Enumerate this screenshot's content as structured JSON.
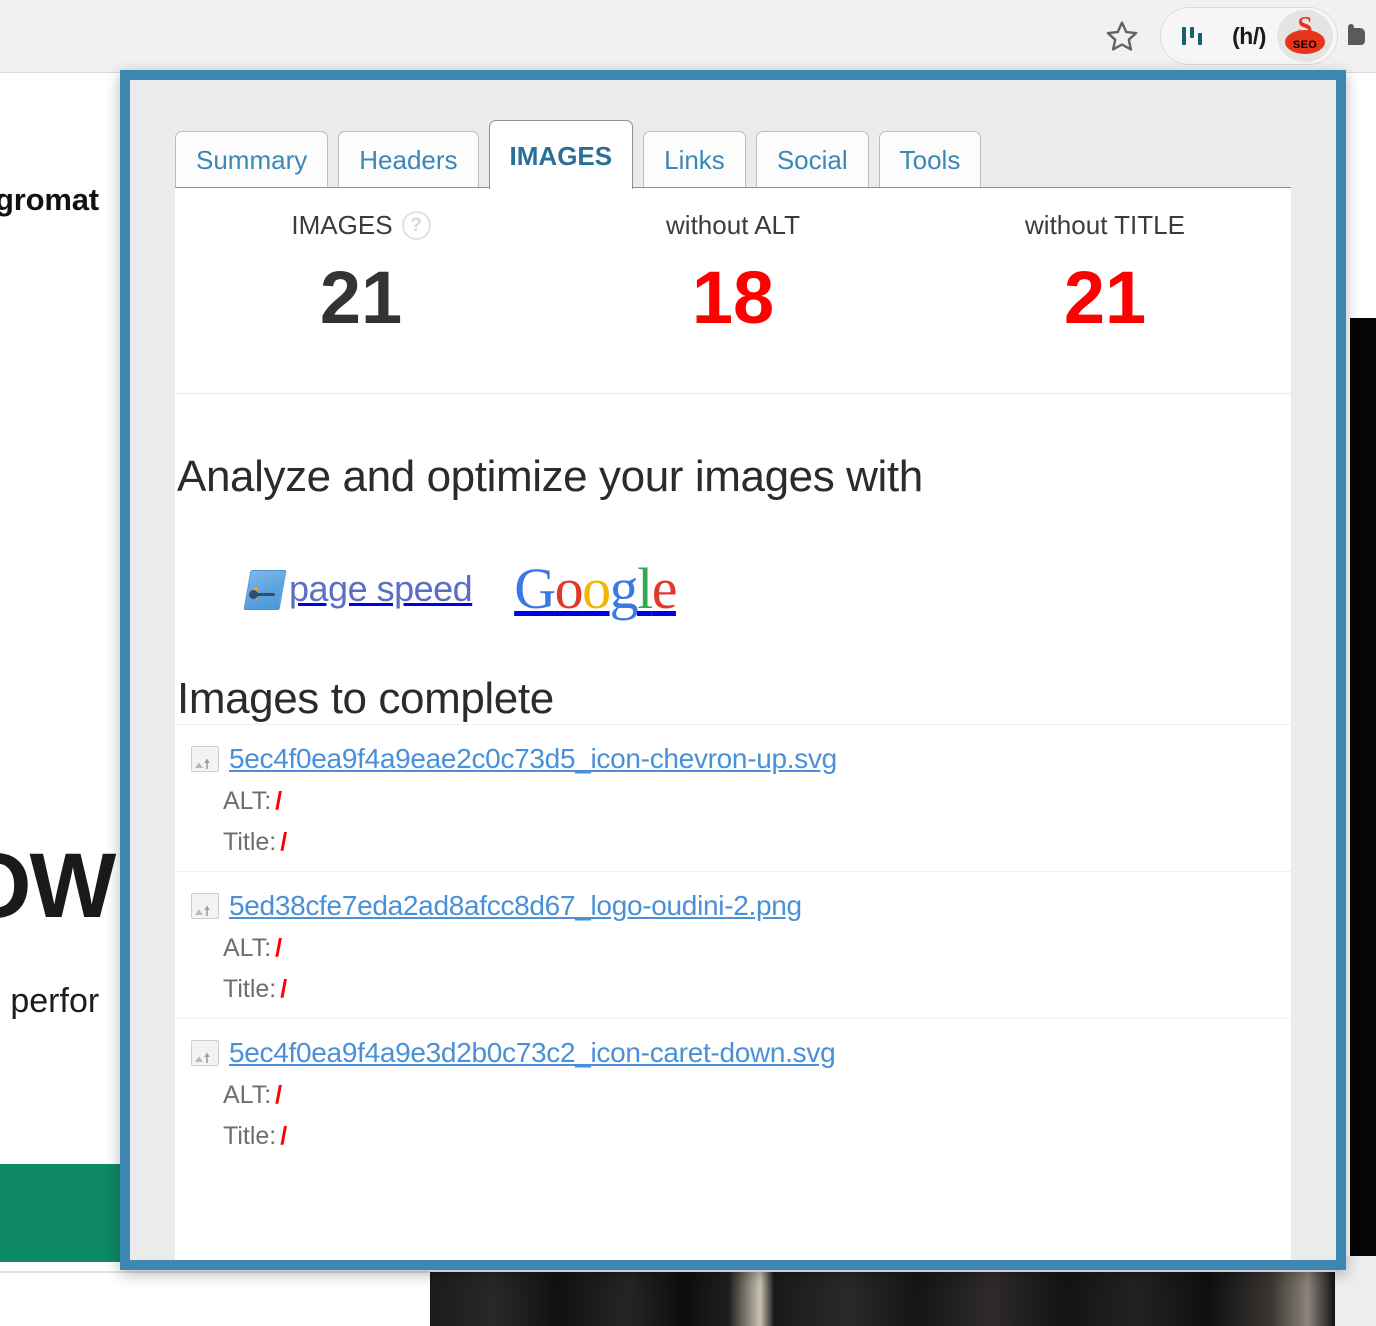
{
  "background_page": {
    "text_top": "egromat",
    "heading": "OW",
    "text_mid": "e perfor",
    "green_button_color": "#0d8a63"
  },
  "browser_toolbar": {
    "bookmark_icon": "star-icon",
    "extensions": [
      {
        "name": "analytics-bars-icon",
        "label": ""
      },
      {
        "name": "h-slash-icon",
        "label": "(h/)"
      },
      {
        "name": "seo-extension-icon",
        "label": "SEO",
        "brand_color": "#e8341c"
      }
    ]
  },
  "popup": {
    "border_color": "#3f87b3",
    "tabs": [
      {
        "label": "Summary",
        "active": false
      },
      {
        "label": "Headers",
        "active": false
      },
      {
        "label": "IMAGES",
        "active": true
      },
      {
        "label": "Links",
        "active": false
      },
      {
        "label": "Social",
        "active": false
      },
      {
        "label": "Tools",
        "active": false
      }
    ],
    "stats": [
      {
        "label": "IMAGES",
        "value": "21",
        "alert": false,
        "help": "?"
      },
      {
        "label": "without ALT",
        "value": "18",
        "alert": true
      },
      {
        "label": "without TITLE",
        "value": "21",
        "alert": true
      }
    ],
    "analyze": {
      "title": "Analyze and optimize your images with",
      "page_speed_label": "page speed",
      "google_letters": [
        "G",
        "o",
        "o",
        "g",
        "l",
        "e"
      ]
    },
    "images_list": {
      "title": "Images to complete",
      "alt_label": "ALT:",
      "title_label": "Title:",
      "empty_value": "/",
      "items": [
        {
          "filename": "5ec4f0ea9f4a9eae2c0c73d5_icon-chevron-up.svg",
          "alt": "/",
          "title": "/"
        },
        {
          "filename": "5ed38cfe7eda2ad8afcc8d67_logo-oudini-2.png",
          "alt": "/",
          "title": "/"
        },
        {
          "filename": "5ec4f0ea9f4a9e3d2b0c73c2_icon-caret-down.svg",
          "alt": "/",
          "title": "/"
        }
      ]
    }
  }
}
